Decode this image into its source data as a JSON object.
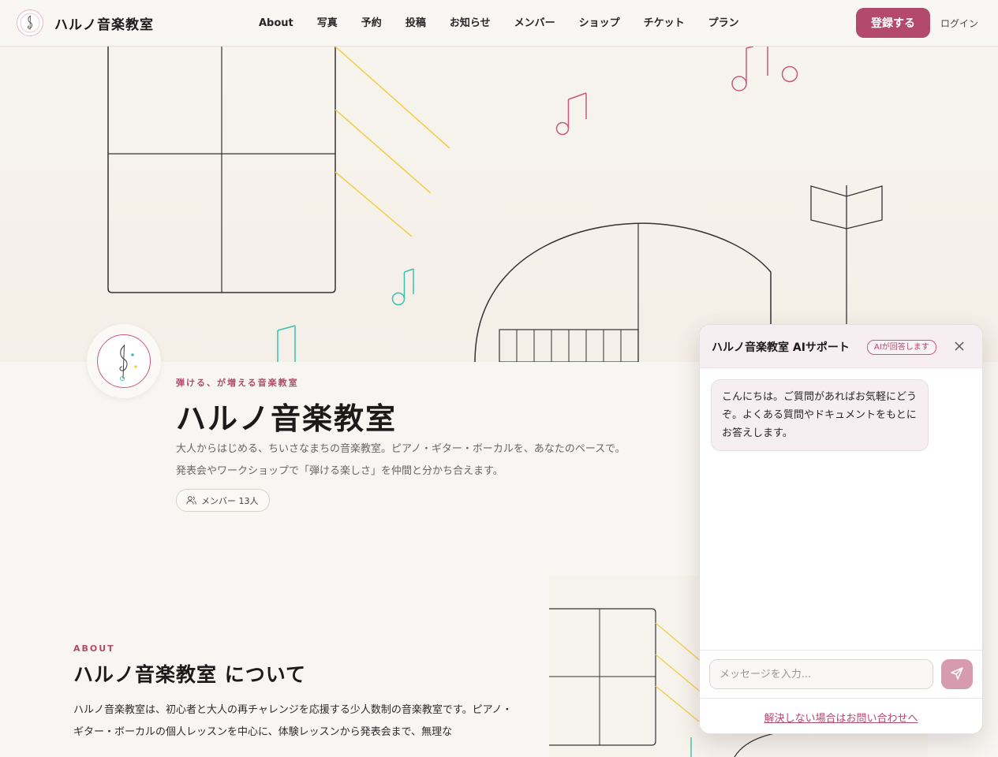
{
  "header": {
    "brand_name": "ハルノ音楽教室",
    "nav": [
      "About",
      "写真",
      "予約",
      "投稿",
      "お知らせ",
      "メンバー",
      "ショップ",
      "チケット",
      "プラン"
    ],
    "register_label": "登録する",
    "login_label": "ログイン"
  },
  "hero": {
    "tagline": "弾ける、が増える音楽教室",
    "title": "ハルノ音楽教室",
    "description_line1": "大人からはじめる、ちいさなまちの音楽教室。ピアノ・ギター・ボーカルを、あなたのペースで。",
    "description_line2": "発表会やワークショップで「弾ける楽しさ」を仲間と分かち合えます。",
    "member_chip": "メンバー 13人"
  },
  "about": {
    "kicker": "ABOUT",
    "title": "ハルノ音楽教室 について",
    "body": "ハルノ音楽教室は、初心者と大人の再チャレンジを応援する少人数制の音楽教室です。ピアノ・ギター・ボーカルの個人レッスンを中心に、体験レッスンから発表会まで、無理な"
  },
  "chat": {
    "title": "ハルノ音楽教室 AIサポート",
    "badge": "AIが回答します",
    "greeting": "こんにちは。ご質問があればお気軽にどうぞ。よくある質問やドキュメントをもとにお答えします。",
    "input_placeholder": "メッセージを入力...",
    "footer_link": "解決しない場合はお問い合わせへ"
  },
  "colors": {
    "accent": "#b34a6e",
    "accent_light": "#d79bb0",
    "note_pink": "#c75a7f",
    "note_teal": "#3bbfb0",
    "line_yellow": "#f2cf4f",
    "background": "#f8f6f2"
  }
}
